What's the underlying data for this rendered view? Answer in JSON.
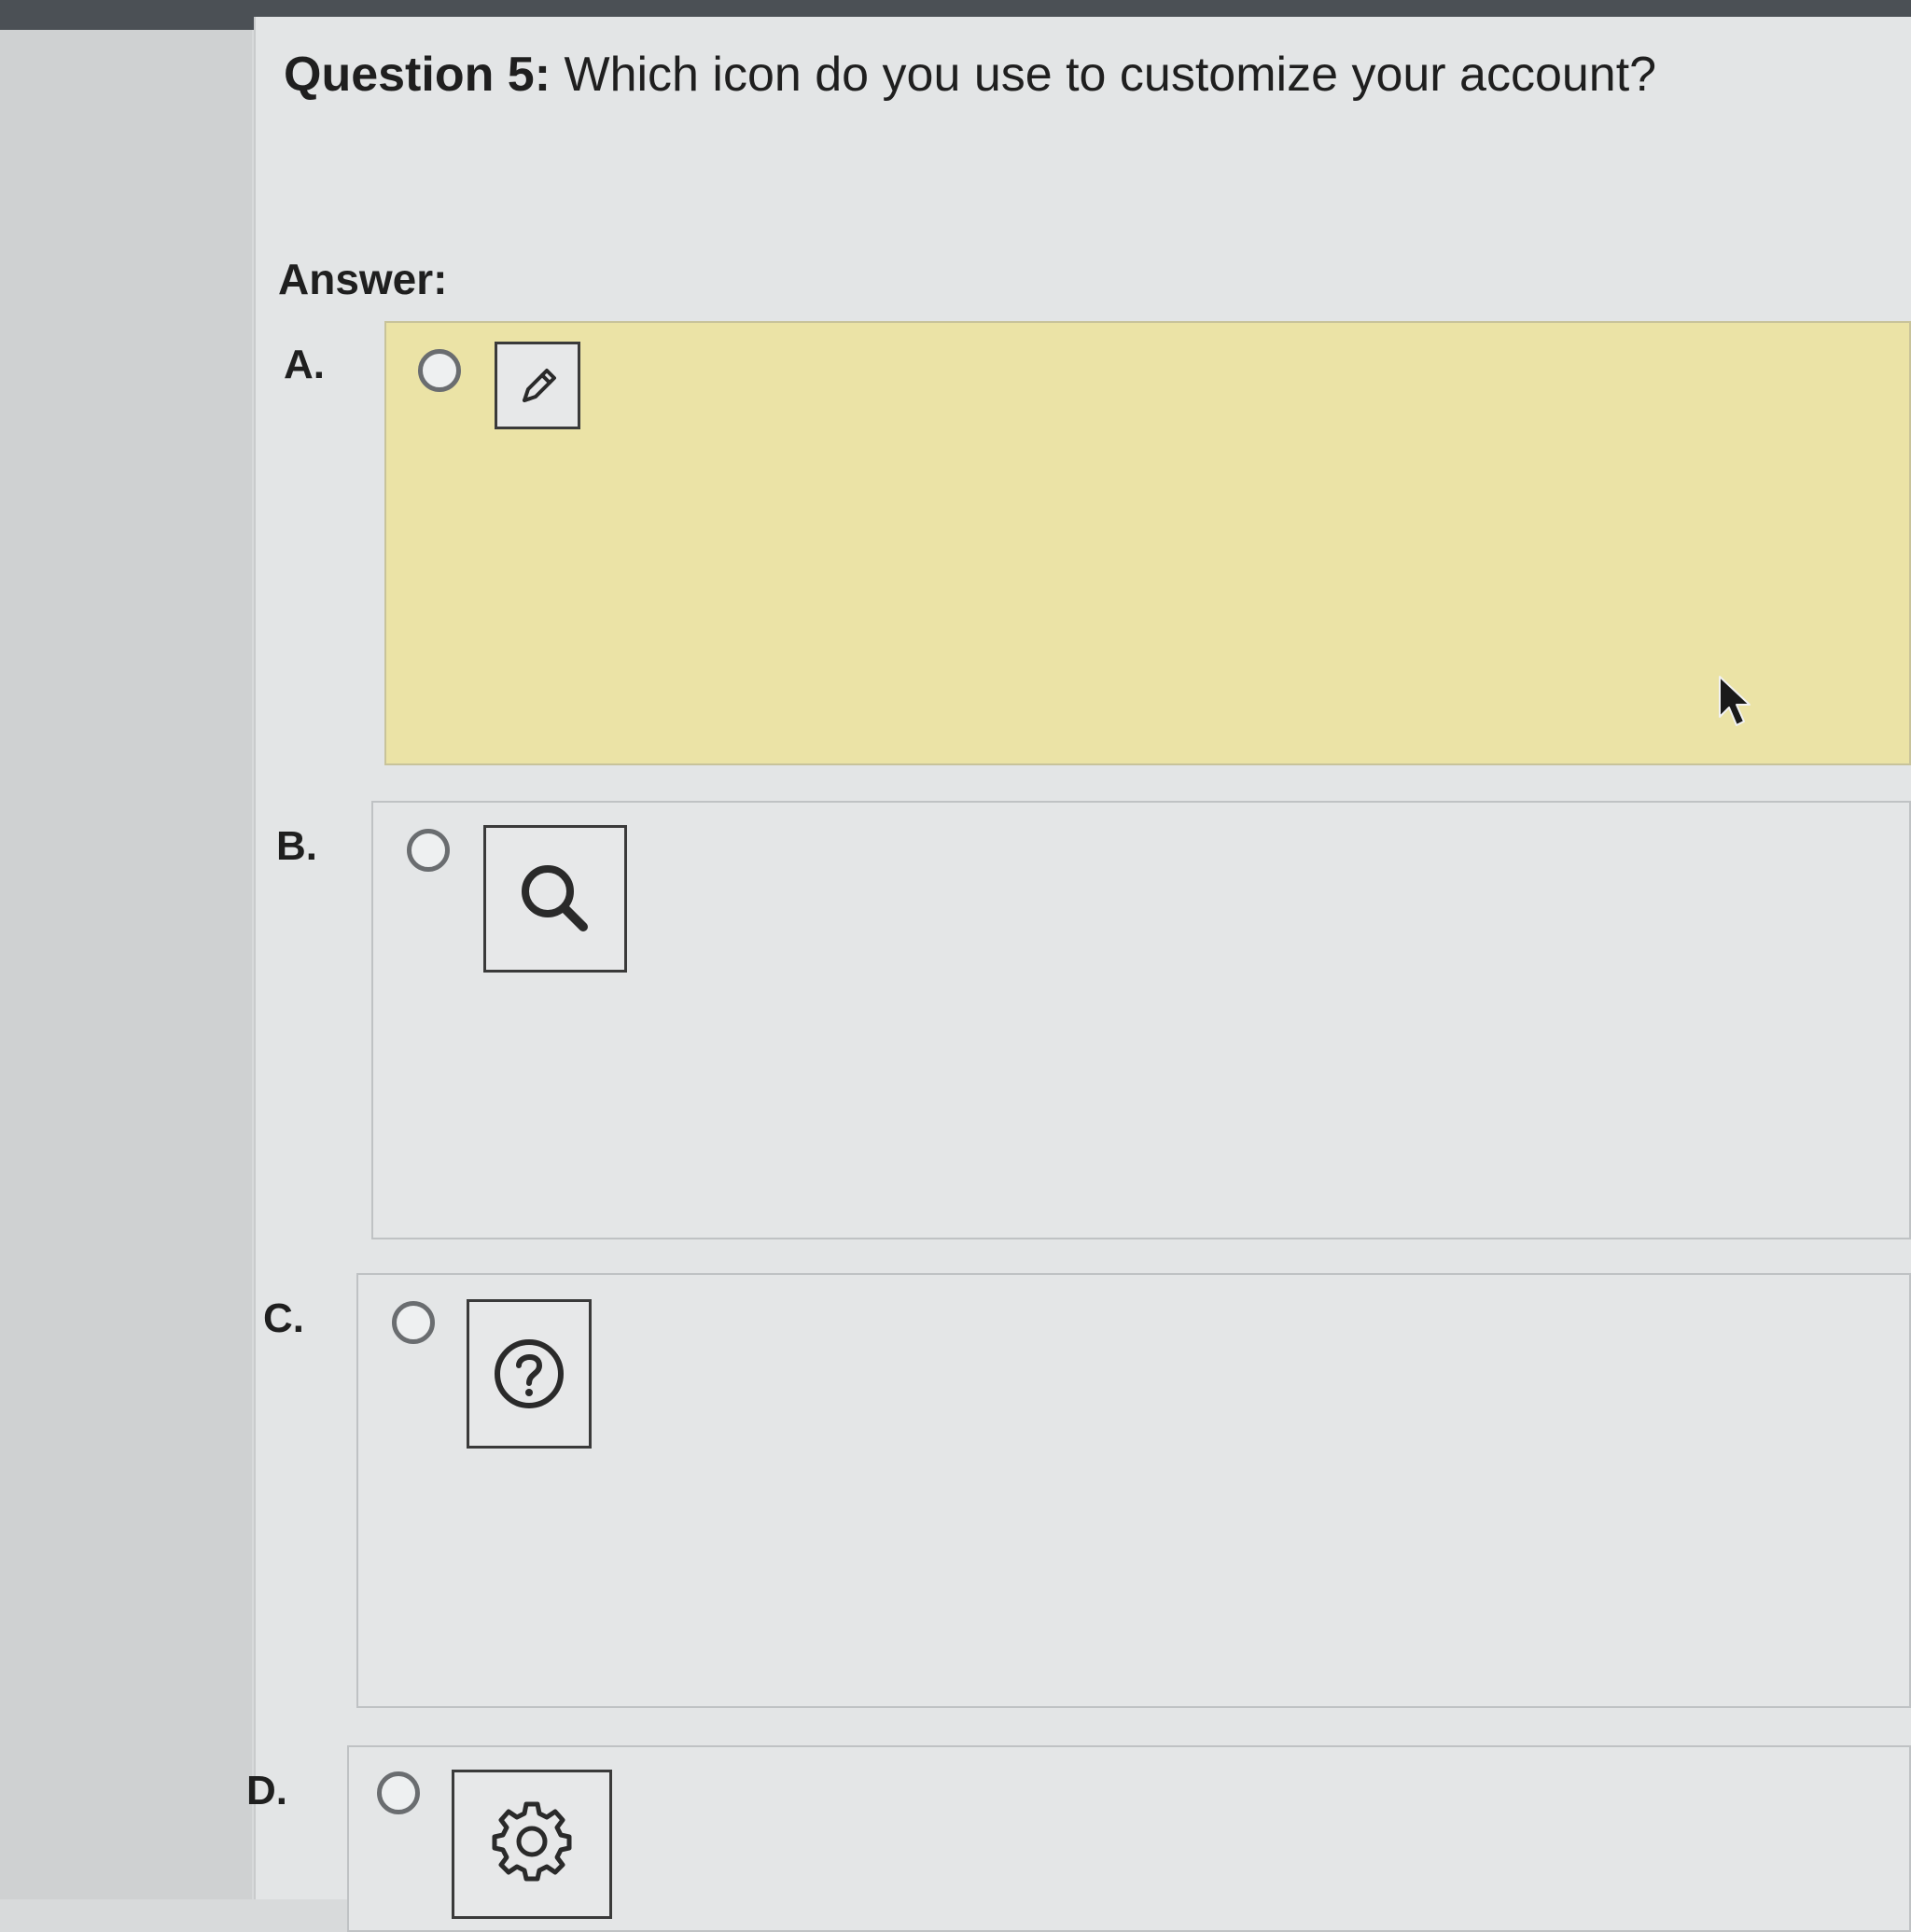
{
  "question": {
    "number_label": "Question 5:",
    "text": "Which icon do you use to customize your account?"
  },
  "answer_label": "Answer:",
  "options": [
    {
      "letter": "A.",
      "icon": "pencil-icon",
      "selected": true
    },
    {
      "letter": "B.",
      "icon": "search-icon",
      "selected": false
    },
    {
      "letter": "C.",
      "icon": "help-icon",
      "selected": false
    },
    {
      "letter": "D.",
      "icon": "gear-icon",
      "selected": false
    }
  ],
  "colors": {
    "selected_background": "#ebe3a6",
    "option_background": "#e4e6e7",
    "page_background": "#e3e5e6"
  }
}
